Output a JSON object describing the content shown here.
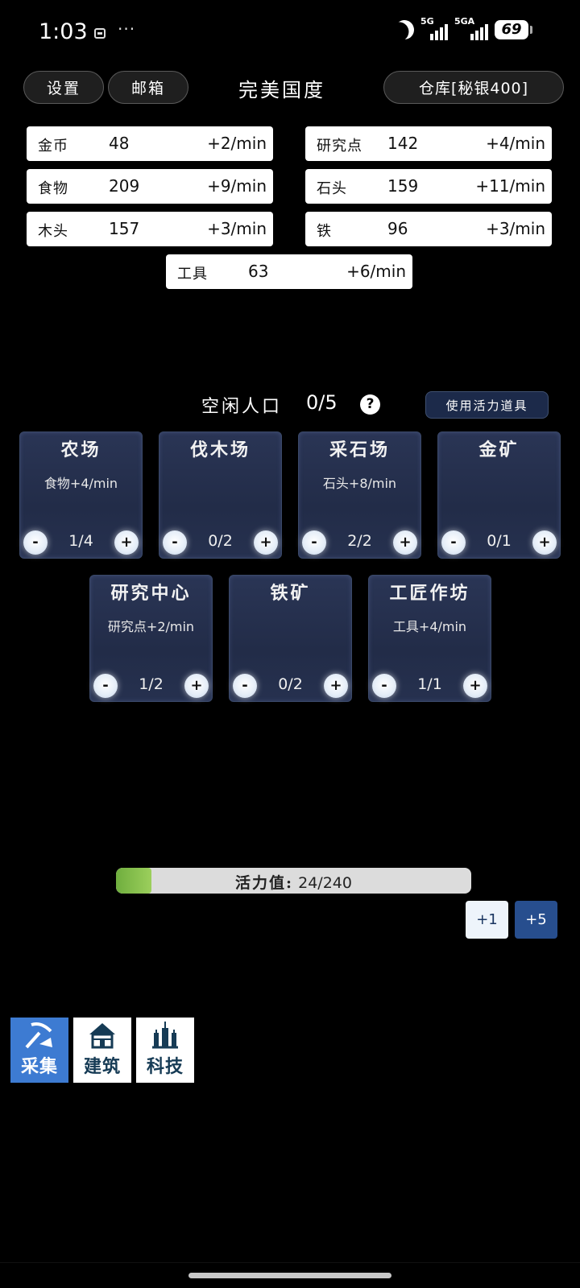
{
  "status_bar": {
    "time": "1:03",
    "dots": "···",
    "net1": "5G",
    "net2": "5GA",
    "battery": "69"
  },
  "header": {
    "settings_label": "设置",
    "mailbox_label": "邮箱",
    "title": "完美国度",
    "warehouse_label": "仓库[秘银400]"
  },
  "resources": [
    {
      "name": "金币",
      "value": "48",
      "rate": "+2/min"
    },
    {
      "name": "研究点",
      "value": "142",
      "rate": "+4/min"
    },
    {
      "name": "食物",
      "value": "209",
      "rate": "+9/min"
    },
    {
      "name": "石头",
      "value": "159",
      "rate": "+11/min"
    },
    {
      "name": "木头",
      "value": "157",
      "rate": "+3/min"
    },
    {
      "name": "铁",
      "value": "96",
      "rate": "+3/min"
    },
    {
      "name": "工具",
      "value": "63",
      "rate": "+6/min"
    }
  ],
  "population": {
    "label": "空闲人口",
    "value": "0/5",
    "help": "?",
    "use_item_label": "使用活力道具"
  },
  "buildings": [
    {
      "name": "农场",
      "production": "食物+4/min",
      "count": "1/4"
    },
    {
      "name": "伐木场",
      "production": "",
      "count": "0/2"
    },
    {
      "name": "采石场",
      "production": "石头+8/min",
      "count": "2/2"
    },
    {
      "name": "金矿",
      "production": "",
      "count": "0/1"
    },
    {
      "name": "研究中心",
      "production": "研究点+2/min",
      "count": "1/2"
    },
    {
      "name": "铁矿",
      "production": "",
      "count": "0/2"
    },
    {
      "name": "工匠作坊",
      "production": "工具+4/min",
      "count": "1/1"
    }
  ],
  "controls": {
    "minus": "-",
    "plus": "+"
  },
  "vitality": {
    "label": "活力值:",
    "value": "24/240",
    "fraction": 0.1,
    "btn_plus1": "+1",
    "btn_plus5": "+5"
  },
  "nav": {
    "gather": "采集",
    "build": "建筑",
    "tech": "科技",
    "active": "gather"
  },
  "colors": {
    "card_bg": "#26314f",
    "accent_blue": "#3d7bd2",
    "dark_blue_button": "#274e8e",
    "vitality_green": "#7fbf4a"
  }
}
